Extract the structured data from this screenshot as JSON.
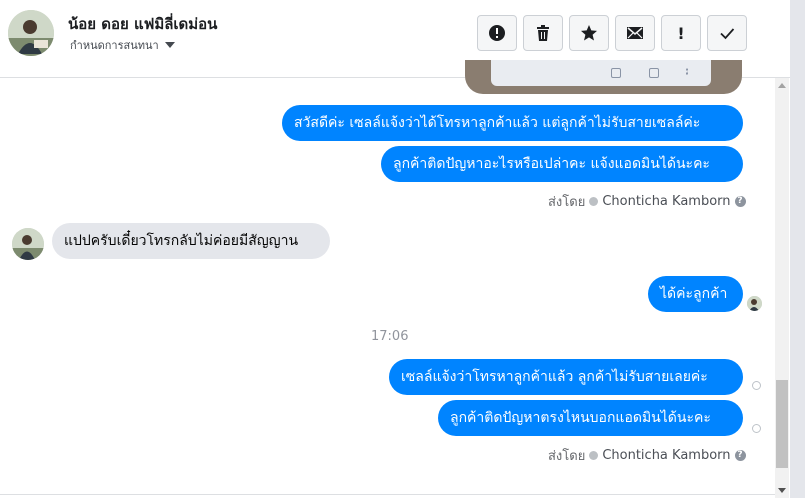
{
  "header": {
    "contact_name": "น้อย ดอย แฟมิลี่เดม่อน",
    "settings_label": "กำหนดการสนทนา",
    "actions": [
      {
        "name": "mark-spam",
        "icon": "alert-circle-icon"
      },
      {
        "name": "delete",
        "icon": "trash-icon"
      },
      {
        "name": "star",
        "icon": "star-icon"
      },
      {
        "name": "mark-unread",
        "icon": "envelope-icon"
      },
      {
        "name": "follow-up",
        "icon": "exclamation-icon",
        "glyph": "!"
      },
      {
        "name": "mark-done",
        "icon": "checkmark-icon"
      }
    ]
  },
  "messages": {
    "out_1": "สวัสดีค่ะ เซลล์แจ้งว่าได้โทรหาลูกค้าแล้ว แต่ลูกค้าไม่รับสายเซลล์ค่ะ",
    "out_2": "ลูกค้าติดปัญหาอะไรหรือเปล่าคะ แจ้งแอดมินได้นะคะ",
    "in_1": "แปปครับเดี๋ยวโทรกลับไม่ค่อยมีสัญญาน",
    "out_3": "ได้ค่ะลูกค้า",
    "out_4": "เซลล์แจ้งว่าโทรหาลูกค้าแล้ว ลูกค้าไม่รับสายเลยค่ะ",
    "out_5": "ลูกค้าติดปัญหาตรงไหนบอกแอดมินได้นะคะ"
  },
  "sent_by": {
    "label": "ส่งโดย",
    "name": "Chonticha Kamborn",
    "help_glyph": "?"
  },
  "time_separator": "17:06",
  "colors": {
    "outgoing_bubble": "#0084ff",
    "incoming_bubble": "#e4e6eb",
    "meta_text": "#65676b"
  }
}
